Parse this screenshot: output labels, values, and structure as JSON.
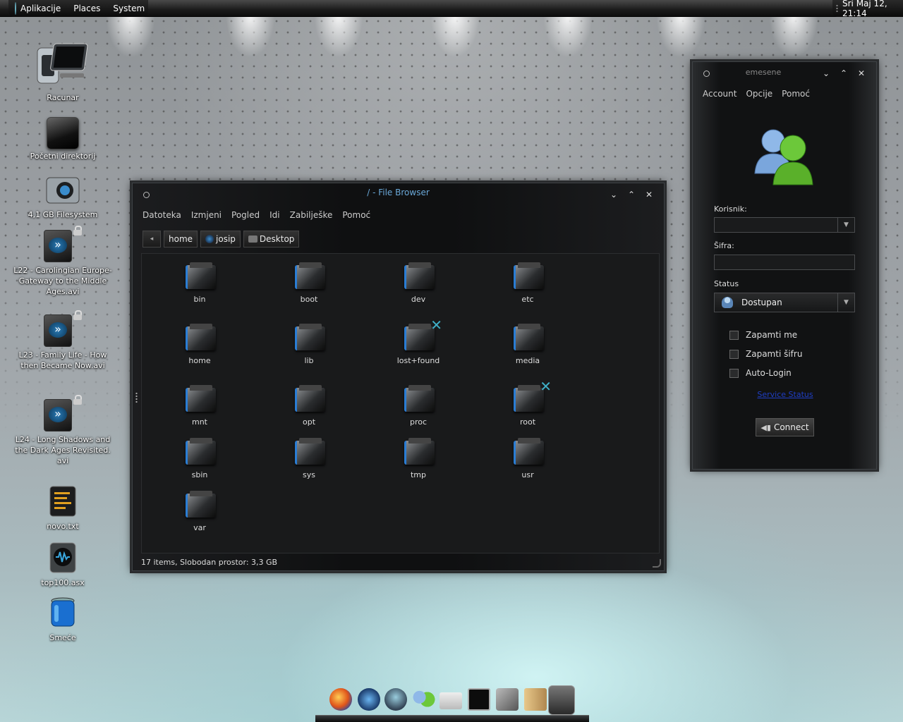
{
  "top_panel": {
    "menus": [
      "Aplikacije",
      "Places",
      "System"
    ],
    "clock": "Sri Maj 12, 21:14"
  },
  "desktop_icons": [
    {
      "label": "Racunar",
      "icon": "computer-icon"
    },
    {
      "label": "Početni direktorij",
      "icon": "home-folder-icon"
    },
    {
      "label": "4,1 GB Filesystem",
      "icon": "drive-icon"
    },
    {
      "label": "L22 - Carolingian Europe- Gateway to the Middle Ages.avi",
      "icon": "video-file-icon"
    },
    {
      "label": "L23 - Family Life - How then Became Now.avi",
      "icon": "video-file-icon"
    },
    {
      "label": "L24 - Long Shadows and the Dark Ages Revisited. avi",
      "icon": "video-file-icon"
    },
    {
      "label": "novo.txt",
      "icon": "text-file-icon"
    },
    {
      "label": "top100.asx",
      "icon": "playlist-file-icon"
    },
    {
      "label": "Smeće",
      "icon": "trash-icon"
    }
  ],
  "file_browser": {
    "title": "/ - File Browser",
    "menu": [
      "Datoteka",
      "Izmjeni",
      "Pogled",
      "Idi",
      "Zabilješke",
      "Pomoć"
    ],
    "path": [
      "home",
      "josip",
      "Desktop"
    ],
    "items": [
      "bin",
      "boot",
      "dev",
      "etc",
      "home",
      "lib",
      "lost+found",
      "media",
      "mnt",
      "opt",
      "proc",
      "root",
      "sbin",
      "sys",
      "tmp",
      "usr",
      "var"
    ],
    "status": "17 items, Slobodan prostor: 3,3 GB"
  },
  "emesene": {
    "title": "emesene",
    "menu": [
      "Account",
      "Opcije",
      "Pomoć"
    ],
    "user_label": "Korisnik:",
    "user_value": "",
    "password_label": "Šifra:",
    "status_label": "Status",
    "status_value": "Dostupan",
    "remember_me": "Zapamti me",
    "remember_password": "Zapamti šifru",
    "auto_login": "Auto-Login",
    "service_status": "Service Status",
    "connect": "Connect"
  },
  "dock_items": [
    "firefox-icon",
    "webcam-icon",
    "browser-icon",
    "messenger-icon",
    "mail-icon",
    "terminal-icon",
    "network-icon",
    "file-manager-icon",
    "show-desktop-icon"
  ]
}
